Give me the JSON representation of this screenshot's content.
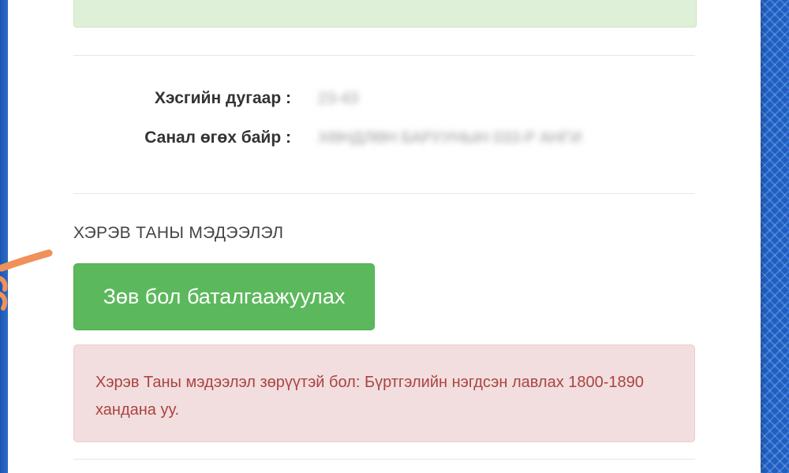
{
  "info": {
    "rows": [
      {
        "label": "Хэсгийн дугаар :",
        "value": "23-43"
      },
      {
        "label": "Санал өгөх байр :",
        "value": "ХӨНДЛӨН БАРУУНЫН 033-Р АНГИ"
      }
    ]
  },
  "section": {
    "heading": "ХЭРЭВ ТАНЫ МЭДЭЭЛЭЛ"
  },
  "confirm_button": {
    "label": "Зөв бол баталгаажуулах",
    "color": "#5cb85c"
  },
  "alert": {
    "text": "Хэрэв Таны мэдээлэл зөрүүтэй бол: Бүртгэлийн нэгдсэн лавлах 1800-1890 хандана уу.",
    "background": "#f2dede",
    "text_color": "#a94442"
  },
  "success_box": {
    "background": "#dff0d8"
  },
  "annotation": {
    "icon": "hand-pointer-icon",
    "color": "#f0915a"
  }
}
